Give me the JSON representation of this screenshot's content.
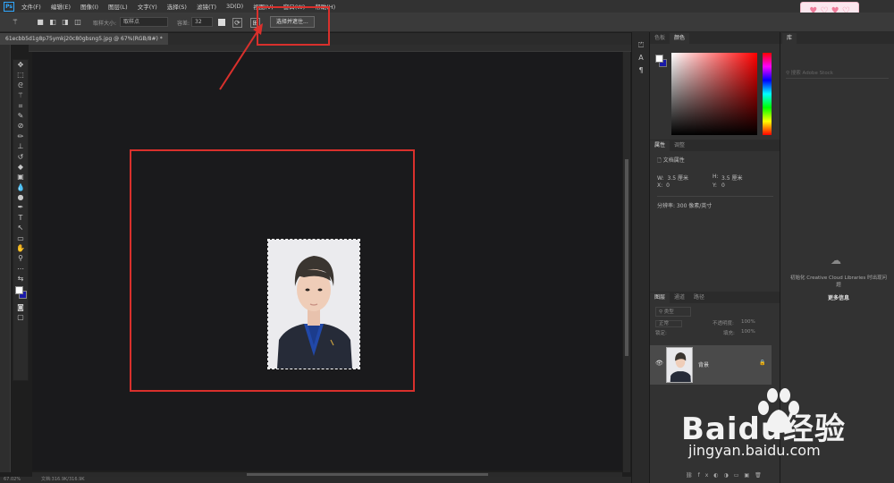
{
  "app": {
    "logo": "Ps",
    "window_controls": [
      "—",
      "□",
      "✕"
    ]
  },
  "menu": [
    "文件(F)",
    "编辑(E)",
    "图像(I)",
    "图层(L)",
    "文字(Y)",
    "选择(S)",
    "滤镜(T)",
    "3D(D)",
    "视图(V)",
    "窗口(W)",
    "帮助(H)"
  ],
  "options": {
    "sample_size_label": "取样大小:",
    "sample_size_value": "取样点",
    "tolerance_label": "容差:",
    "tolerance_value": "32",
    "select_mask_button": "选择并遮住..."
  },
  "document": {
    "tab_title": "61ecbb5d1g8p75ymkj20c80gbsng5.jpg @ 67%(RGB/8#) *",
    "zoom": "67.02%",
    "doc_size": "文档:316.9K/316.9K"
  },
  "color_panel": {
    "tabs": [
      "色板",
      "颜色"
    ],
    "foreground": "#ffffff",
    "background": "#1a1aa8"
  },
  "properties_panel": {
    "tabs": [
      "属性",
      "调整"
    ],
    "section": "文档属性",
    "w_label": "W:",
    "w_value": "3.5 厘米",
    "h_label": "H:",
    "h_value": "3.5 厘米",
    "x_label": "X:",
    "x_value": "0",
    "y_label": "Y:",
    "y_value": "0",
    "resolution": "分辨率: 300 像素/英寸"
  },
  "layers_panel": {
    "tabs": [
      "图层",
      "通道",
      "路径"
    ],
    "kind_filter": "类型",
    "blend_mode": "正常",
    "opacity_label": "不透明度:",
    "opacity_value": "100%",
    "lock_label": "锁定:",
    "fill_label": "填充:",
    "fill_value": "100%",
    "layer_name": "背景"
  },
  "libraries_panel": {
    "tab": "库",
    "search_placeholder": "搜索 Adobe Stock",
    "message": "初始化 Creative Cloud Libraries 时出现问题",
    "more_link": "更多信息"
  },
  "watermark": {
    "brand": "Baidu经验",
    "url": "jingyan.baidu.com"
  },
  "annotation": {
    "color": "#d9302c"
  }
}
